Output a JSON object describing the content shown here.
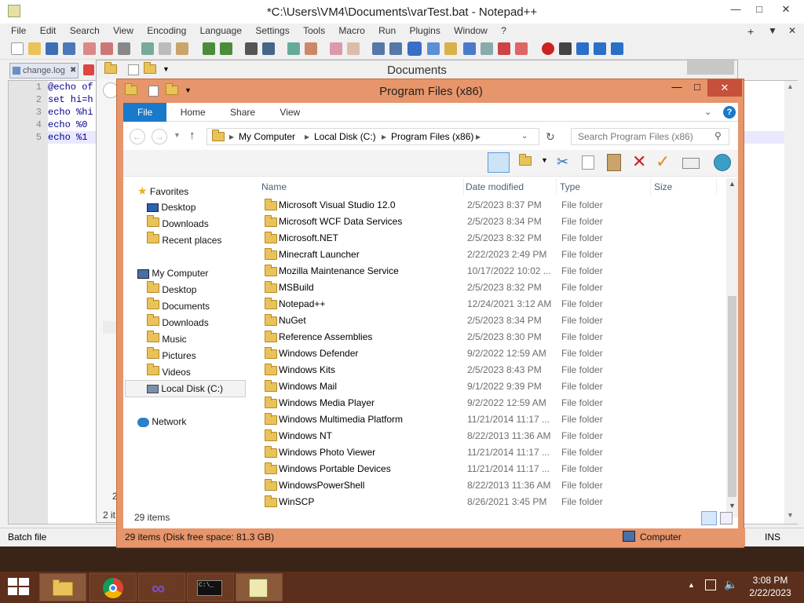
{
  "npp": {
    "title": "*C:\\Users\\VM4\\Documents\\varTest.bat - Notepad++",
    "menu": [
      "File",
      "Edit",
      "Search",
      "View",
      "Encoding",
      "Language",
      "Settings",
      "Tools",
      "Macro",
      "Run",
      "Plugins",
      "Window",
      "?"
    ],
    "tab": "change.log",
    "lines": [
      "1",
      "2",
      "3",
      "4",
      "5"
    ],
    "code": [
      "@echo of",
      "set hi=h",
      "echo %hi",
      "echo %0",
      "echo %1"
    ],
    "status_left": "Batch file",
    "status_right": "INS",
    "partial_count": "2 it",
    "partial_2": "2"
  },
  "docs": {
    "title": "Documents"
  },
  "explorer": {
    "title": "Program Files (x86)",
    "tabs": [
      "File",
      "Home",
      "Share",
      "View"
    ],
    "breadcrumb": [
      "My Computer",
      "Local Disk (C:)",
      "Program Files (x86)"
    ],
    "search_placeholder": "Search Program Files (x86)",
    "columns": {
      "name": "Name",
      "date": "Date modified",
      "type": "Type",
      "size": "Size"
    },
    "nav": {
      "favorites": "Favorites",
      "desktop": "Desktop",
      "downloads": "Downloads",
      "recent": "Recent places",
      "mycomputer": "My Computer",
      "pc_desktop": "Desktop",
      "documents": "Documents",
      "pc_downloads": "Downloads",
      "music": "Music",
      "pictures": "Pictures",
      "videos": "Videos",
      "localdisk": "Local Disk (C:)",
      "network": "Network"
    },
    "files": [
      {
        "name": "Microsoft Visual Studio 12.0",
        "date": "2/5/2023 8:37 PM",
        "type": "File folder"
      },
      {
        "name": "Microsoft WCF Data Services",
        "date": "2/5/2023 8:34 PM",
        "type": "File folder"
      },
      {
        "name": "Microsoft.NET",
        "date": "2/5/2023 8:32 PM",
        "type": "File folder"
      },
      {
        "name": "Minecraft Launcher",
        "date": "2/22/2023 2:49 PM",
        "type": "File folder"
      },
      {
        "name": "Mozilla Maintenance Service",
        "date": "10/17/2022 10:02 ...",
        "type": "File folder"
      },
      {
        "name": "MSBuild",
        "date": "2/5/2023 8:32 PM",
        "type": "File folder"
      },
      {
        "name": "Notepad++",
        "date": "12/24/2021 3:12 AM",
        "type": "File folder"
      },
      {
        "name": "NuGet",
        "date": "2/5/2023 8:34 PM",
        "type": "File folder"
      },
      {
        "name": "Reference Assemblies",
        "date": "2/5/2023 8:30 PM",
        "type": "File folder"
      },
      {
        "name": "Windows Defender",
        "date": "9/2/2022 12:59 AM",
        "type": "File folder"
      },
      {
        "name": "Windows Kits",
        "date": "2/5/2023 8:43 PM",
        "type": "File folder"
      },
      {
        "name": "Windows Mail",
        "date": "9/1/2022 9:39 PM",
        "type": "File folder"
      },
      {
        "name": "Windows Media Player",
        "date": "9/2/2022 12:59 AM",
        "type": "File folder"
      },
      {
        "name": "Windows Multimedia Platform",
        "date": "11/21/2014 11:17 ...",
        "type": "File folder"
      },
      {
        "name": "Windows NT",
        "date": "8/22/2013 11:36 AM",
        "type": "File folder"
      },
      {
        "name": "Windows Photo Viewer",
        "date": "11/21/2014 11:17 ...",
        "type": "File folder"
      },
      {
        "name": "Windows Portable Devices",
        "date": "11/21/2014 11:17 ...",
        "type": "File folder"
      },
      {
        "name": "WindowsPowerShell",
        "date": "8/22/2013 11:36 AM",
        "type": "File folder"
      },
      {
        "name": "WinSCP",
        "date": "8/26/2021 3:45 PM",
        "type": "File folder"
      }
    ],
    "item_count": "29 items",
    "status_bar": "29 items (Disk free space: 81.3 GB)",
    "status_location": "Computer"
  },
  "taskbar": {
    "time": "3:08 PM",
    "date": "2/22/2023"
  }
}
